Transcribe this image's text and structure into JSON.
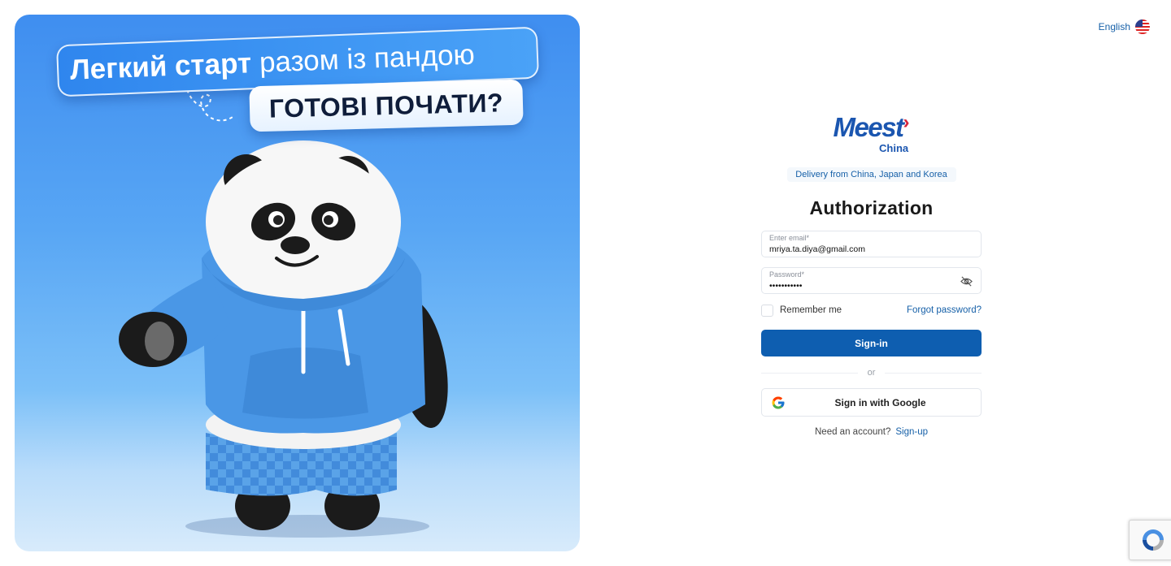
{
  "hero": {
    "headline_bold": "Легкий старт",
    "headline_rest": "разом із пандою",
    "subheadline": "ГОТОВІ ПОЧАТИ?"
  },
  "header": {
    "language": "English",
    "language_flag": "us-flag-icon"
  },
  "brand": {
    "logo_main": "Meest",
    "logo_sub": "China",
    "tagline": "Delivery from China, Japan and Korea",
    "color_primary": "#0e5eb0",
    "color_accent": "#d6243b"
  },
  "form": {
    "title": "Authorization",
    "email_label": "Enter email*",
    "email_value": "mriya.ta.diya@gmail.com",
    "password_label": "Password*",
    "password_value": "•••••••••••",
    "remember_label": "Remember me",
    "remember_checked": false,
    "forgot_label": "Forgot password?",
    "signin_label": "Sign-in",
    "or_label": "or",
    "google_label": "Sign in with Google",
    "need_account": "Need an account?",
    "signup_label": "Sign-up"
  }
}
